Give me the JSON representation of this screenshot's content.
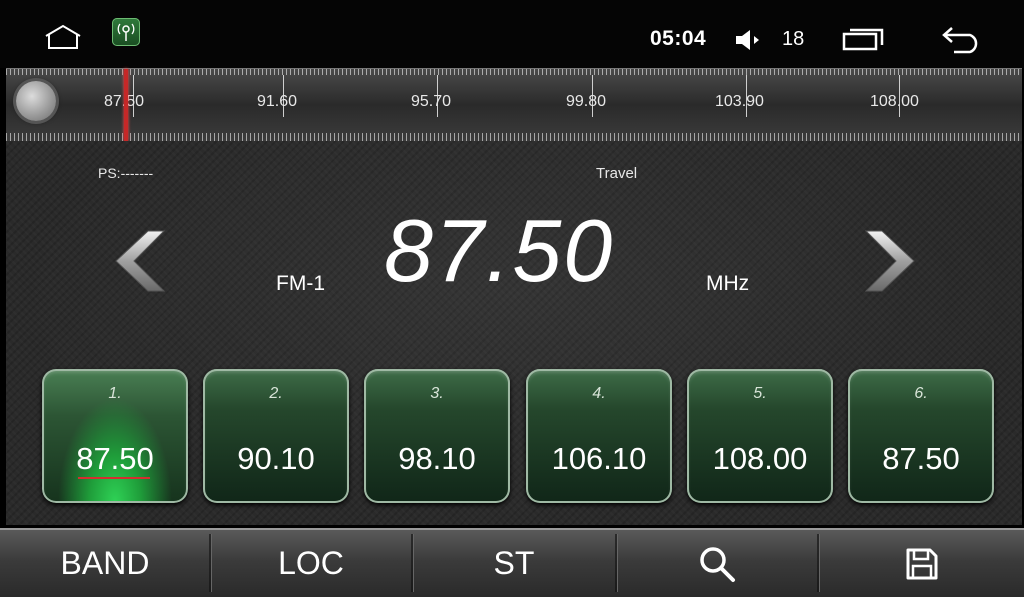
{
  "statusbar": {
    "time": "05:04",
    "volume": "18",
    "icons": [
      "home-icon",
      "radio-app-icon",
      "speaker-icon",
      "recents-icon",
      "back-arrow-icon"
    ]
  },
  "scale": {
    "labels": [
      "87.50",
      "91.60",
      "95.70",
      "99.80",
      "103.90",
      "108.00"
    ],
    "current_frequency": "87.50"
  },
  "display": {
    "ps": "PS:-------",
    "pty": "Travel",
    "band": "FM-1",
    "frequency": "87.50",
    "unit": "MHz"
  },
  "presets": [
    {
      "num": "1.",
      "freq": "87.50",
      "active": true
    },
    {
      "num": "2.",
      "freq": "90.10",
      "active": false
    },
    {
      "num": "3.",
      "freq": "98.10",
      "active": false
    },
    {
      "num": "4.",
      "freq": "106.10",
      "active": false
    },
    {
      "num": "5.",
      "freq": "108.00",
      "active": false
    },
    {
      "num": "6.",
      "freq": "87.50",
      "active": false
    }
  ],
  "bottombar": {
    "band": "BAND",
    "loc": "LOC",
    "st": "ST",
    "search_icon": "search-icon",
    "save_icon": "save-icon"
  },
  "colors": {
    "preset_green": "#25472c",
    "active_glow": "#2fd356",
    "needle": "#c62828"
  }
}
